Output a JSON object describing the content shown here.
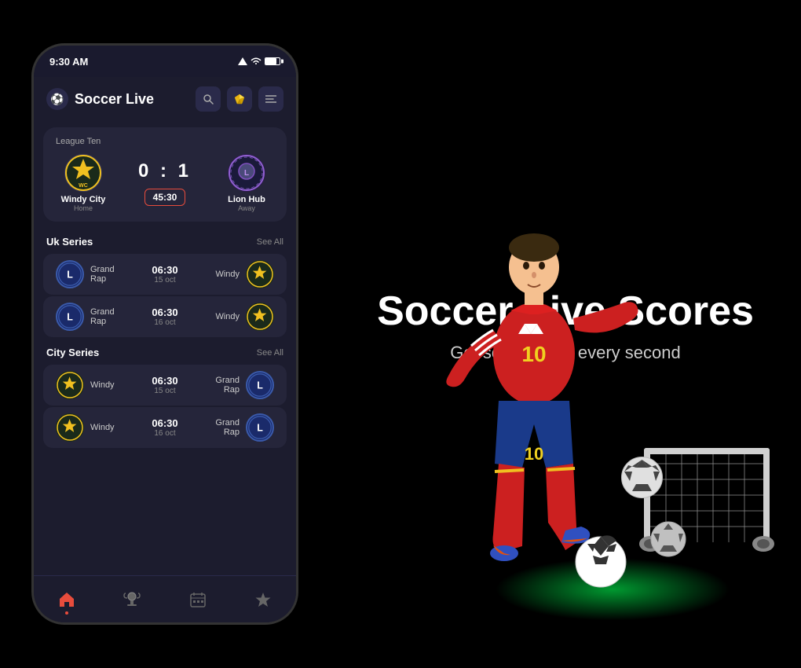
{
  "status_bar": {
    "time": "9:30 AM"
  },
  "app": {
    "title": "Soccer Live",
    "logo": "⚽"
  },
  "header_buttons": {
    "search": "🔍",
    "gem": "💎",
    "menu": "☰"
  },
  "featured_match": {
    "league": "League Ten",
    "home_team": "Windy City",
    "home_type": "Home",
    "away_team": "Lion Hub",
    "away_type": "Away",
    "score": "0 : 1",
    "time": "45:30"
  },
  "uk_series": {
    "title": "Uk Series",
    "see_all": "See All",
    "matches": [
      {
        "home_team": "Grand Rap",
        "time": "06:30",
        "date": "15 oct",
        "away_team": "Windy"
      },
      {
        "home_team": "Grand Rap",
        "time": "06:30",
        "date": "16 oct",
        "away_team": "Windy"
      }
    ]
  },
  "city_series": {
    "title": "City Series",
    "see_all": "See All",
    "matches": [
      {
        "home_team": "Windy",
        "time": "06:30",
        "date": "15 oct",
        "away_team": "Grand Rap"
      },
      {
        "home_team": "Windy",
        "time": "06:30",
        "date": "16 oct",
        "away_team": "Grand Rap"
      }
    ]
  },
  "right_section": {
    "title": "Soccer Live Scores",
    "subtitle": "Get scores after every second"
  },
  "bottom_nav": {
    "home": "🏠",
    "trophy": "🏆",
    "calendar": "📅",
    "star": "⭐"
  }
}
